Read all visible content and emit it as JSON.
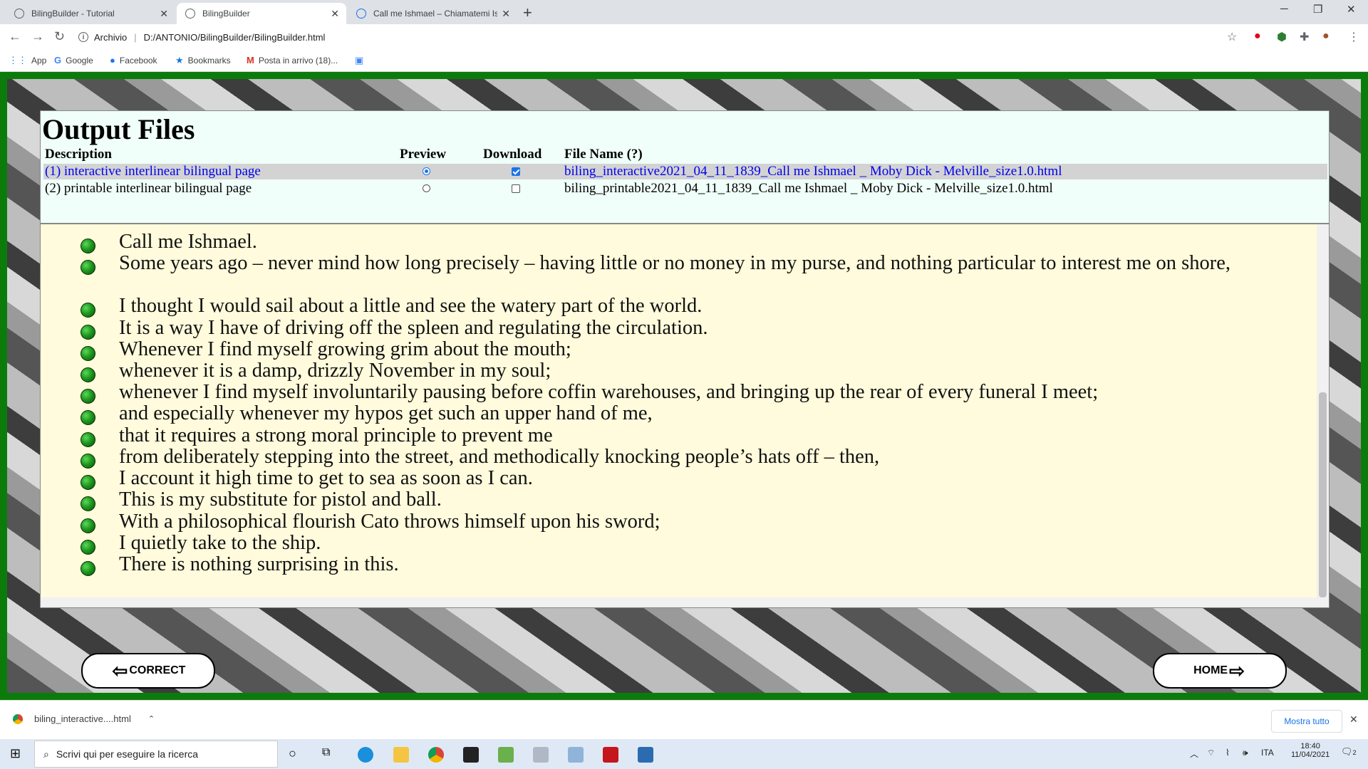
{
  "browser": {
    "tabs": [
      {
        "title": "BilingBuilder - Tutorial",
        "active": false
      },
      {
        "title": "BilingBuilder",
        "active": true
      },
      {
        "title": "Call me Ishmael – Chiamatemi Is",
        "active": false
      }
    ],
    "address": {
      "prefix": "Archivio",
      "url": "D:/ANTONIO/BilingBuilder/BilingBuilder.html"
    },
    "bookmarks": [
      "App",
      "Google",
      "Facebook",
      "Bookmarks",
      "Posta in arrivo (18)..."
    ]
  },
  "output": {
    "title": "Output Files",
    "headers": {
      "description": "Description",
      "preview": "Preview",
      "download": "Download",
      "filename": "File Name (?)"
    },
    "files": [
      {
        "description": "(1) interactive interlinear bilingual page",
        "preview": true,
        "download": true,
        "filename": "biling_interactive2021_04_11_1839_Call me Ishmael _ Moby Dick - Melville_size1.0.html"
      },
      {
        "description": "(2) printable interlinear bilingual page",
        "preview": false,
        "download": false,
        "filename": "biling_printable2021_04_11_1839_Call me Ishmael _ Moby Dick - Melville_size1.0.html"
      }
    ]
  },
  "preview_lines": [
    "Call me Ishmael.",
    "Some years ago – never mind how long precisely – having little or no money in my purse, and nothing particular to interest me on shore,",
    "I thought I would sail about a little and see the watery part of the world.",
    "It is a way I have of driving off the spleen and regulating the circulation.",
    "Whenever I find myself growing grim about the mouth;",
    "whenever it is a damp, drizzly November in my soul;",
    "whenever I find myself involuntarily pausing before coffin warehouses, and bringing up the rear of every funeral I meet;",
    "and especially whenever my hypos get such an upper hand of me,",
    "that it requires a strong moral principle to prevent me",
    "from deliberately stepping into the street, and methodically knocking people’s hats off – then,",
    "I account it high time to get to sea as soon as I can.",
    "This is my substitute for pistol and ball.",
    "With a philosophical flourish Cato throws himself upon his sword;",
    "I quietly take to the ship.",
    "There is nothing surprising in this."
  ],
  "buttons": {
    "correct": "CORRECT",
    "home": "HOME"
  },
  "downloads": {
    "file": "biling_interactive....html",
    "show_all": "Mostra tutto"
  },
  "taskbar": {
    "search_placeholder": "Scrivi qui per eseguire la ricerca",
    "lang": "ITA",
    "time": "18:40",
    "date": "11/04/2021",
    "notifications": "2"
  }
}
